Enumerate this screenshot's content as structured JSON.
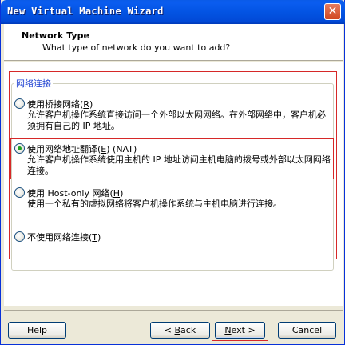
{
  "window": {
    "title": "New Virtual Machine Wizard"
  },
  "header": {
    "title": "Network Type",
    "subtitle": "What type of network do you want to add?"
  },
  "group": {
    "legend": "网络连接"
  },
  "options": [
    {
      "label": "使用桥接网络(R)",
      "label_pre": "使用桥接网络(",
      "mnemonic": "R",
      "label_post": ")",
      "description": "允许客户机操作系统直接访问一个外部以太网网络。在外部网络中，客户机必须拥有自己的 IP 地址。",
      "checked": false
    },
    {
      "label": "使用网络地址翻译(E) (NAT)",
      "label_pre": "使用网络地址翻译(",
      "mnemonic": "E",
      "label_post": ") (NAT)",
      "description": "允许客户机操作系统使用主机的 IP 地址访问主机电脑的拨号或外部以太网网络连接。",
      "checked": true
    },
    {
      "label": "使用 Host-only 网络(H)",
      "label_pre": "使用 Host-only 网络(",
      "mnemonic": "H",
      "label_post": ")",
      "description": "使用一个私有的虚拟网络将客户机操作系统与主机电脑进行连接。",
      "checked": false
    },
    {
      "label": "不使用网络连接(T)",
      "label_pre": "不使用网络连接(",
      "mnemonic": "T",
      "label_post": ")",
      "description": "",
      "checked": false
    }
  ],
  "buttons": {
    "help": "Help",
    "back_pre": "< ",
    "back_mn": "B",
    "back_post": "ack",
    "next_pre": "",
    "next_mn": "N",
    "next_post": "ext >",
    "cancel": "Cancel"
  },
  "colors": {
    "title_bar": "#0354e3",
    "highlight_outline": "#d62828",
    "legend_text": "#1c3fd1",
    "radio_dot": "#21a121"
  }
}
